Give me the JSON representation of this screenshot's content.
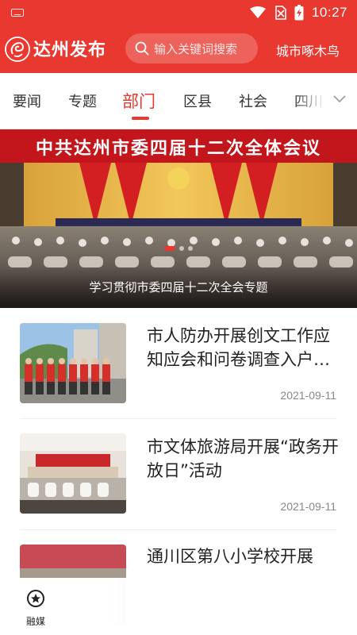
{
  "status_bar": {
    "time": "10:27"
  },
  "header": {
    "brand": "达州发布",
    "search_placeholder": "输入关键词搜索",
    "city": "城市啄木鸟"
  },
  "tabs": [
    {
      "label": "要闻"
    },
    {
      "label": "专题"
    },
    {
      "label": "部门",
      "active": true
    },
    {
      "label": "区县"
    },
    {
      "label": "社会"
    },
    {
      "label": "四川"
    }
  ],
  "banner": {
    "slogan": "中共达州市委四届十二次全体会议",
    "caption": "学习贯彻市委四届十二次全会专题",
    "page_count": 3,
    "active_page": 1
  },
  "news": [
    {
      "title": "市人防办开展创文工作应知应会和问卷调查入户活动",
      "date": "2021-09-11"
    },
    {
      "title": "市文体旅游局开展“政务开放日”活动",
      "date": "2021-09-11"
    },
    {
      "title": "通川区第八小学校开展",
      "date": ""
    }
  ],
  "bottom_nav": {
    "label": "融媒"
  },
  "colors": {
    "accent": "#e8382f"
  }
}
